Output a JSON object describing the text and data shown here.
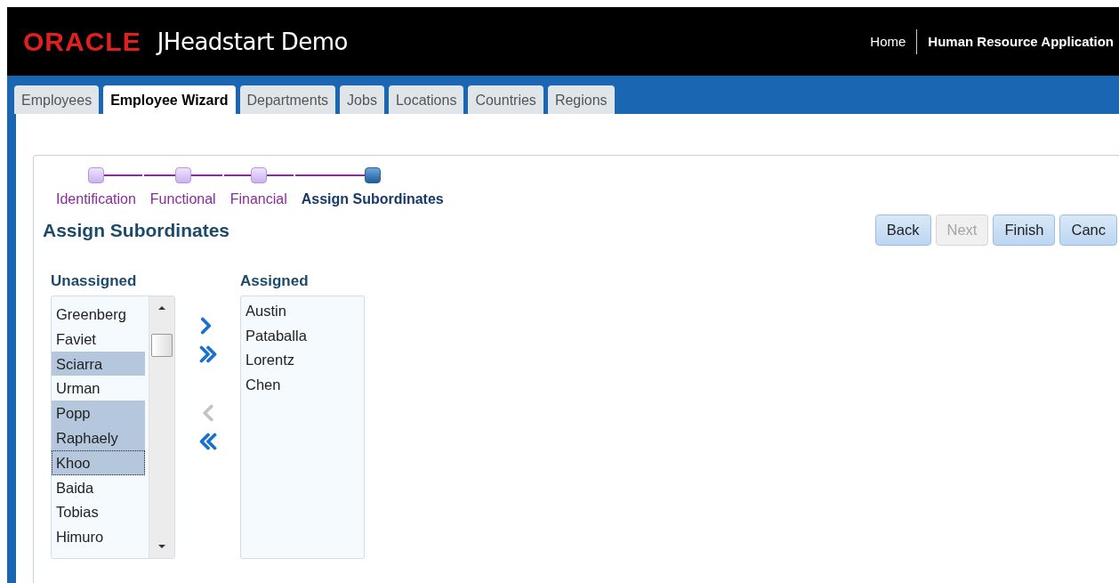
{
  "header": {
    "logo": "ORACLE",
    "title": "JHeadstart Demo",
    "links": [
      "Home",
      "Human Resource Application"
    ]
  },
  "tabs": [
    {
      "label": "Employees",
      "selected": false
    },
    {
      "label": "Employee Wizard",
      "selected": true
    },
    {
      "label": "Departments",
      "selected": false
    },
    {
      "label": "Jobs",
      "selected": false
    },
    {
      "label": "Locations",
      "selected": false
    },
    {
      "label": "Countries",
      "selected": false
    },
    {
      "label": "Regions",
      "selected": false
    }
  ],
  "train": [
    {
      "label": "Identification",
      "selected": false
    },
    {
      "label": "Functional",
      "selected": false
    },
    {
      "label": "Financial",
      "selected": false
    },
    {
      "label": "Assign Subordinates",
      "selected": true
    }
  ],
  "page_title": "Assign Subordinates",
  "buttons": [
    {
      "label": "Back",
      "disabled": false
    },
    {
      "label": "Next",
      "disabled": true
    },
    {
      "label": "Finish",
      "disabled": false
    },
    {
      "label": "Canc",
      "disabled": false
    }
  ],
  "unassigned": {
    "label": "Unassigned",
    "items": [
      {
        "name": "Greenberg",
        "selected": false
      },
      {
        "name": "Faviet",
        "selected": false
      },
      {
        "name": "Sciarra",
        "selected": true
      },
      {
        "name": "Urman",
        "selected": false
      },
      {
        "name": "Popp",
        "selected": true
      },
      {
        "name": "Raphaely",
        "selected": true
      },
      {
        "name": "Khoo",
        "selected": true
      },
      {
        "name": "Baida",
        "selected": false
      },
      {
        "name": "Tobias",
        "selected": false
      },
      {
        "name": "Himuro",
        "selected": false
      }
    ]
  },
  "shuttle_buttons": [
    {
      "kind": "move",
      "disabled": false
    },
    {
      "kind": "move_all",
      "disabled": false
    },
    {
      "kind": "remove",
      "disabled": true
    },
    {
      "kind": "remove_all",
      "disabled": false
    }
  ],
  "assigned": {
    "label": "Assigned",
    "items": [
      "Austin",
      "Pataballa",
      "Lorentz",
      "Chen"
    ]
  }
}
